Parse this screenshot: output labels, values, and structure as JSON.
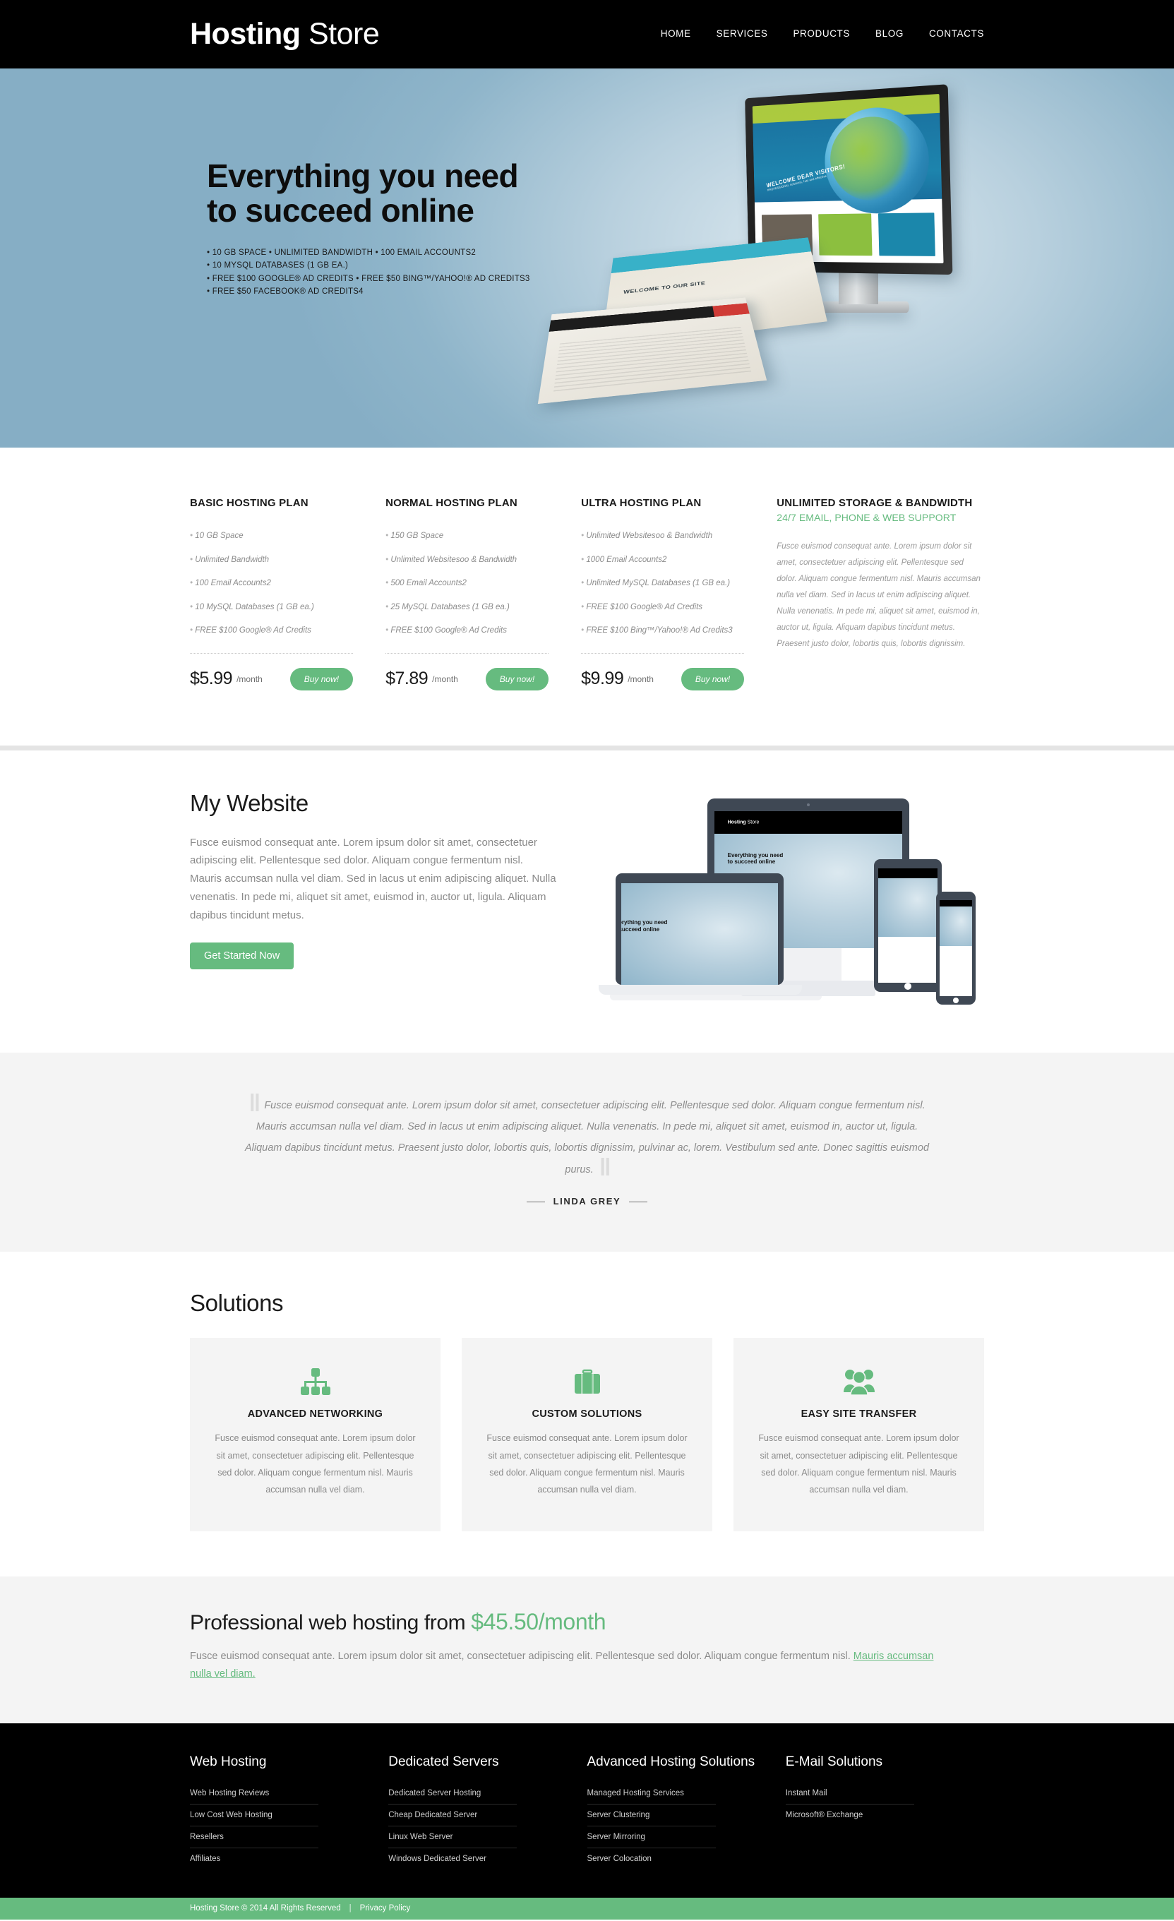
{
  "header": {
    "logo_bold": "Hosting",
    "logo_light": "Store",
    "nav": [
      {
        "label": "HOME"
      },
      {
        "label": "SERVICES"
      },
      {
        "label": "PRODUCTS"
      },
      {
        "label": "BLOG"
      },
      {
        "label": "CONTACTS"
      }
    ]
  },
  "hero": {
    "title_line1": "Everything you need",
    "title_line2": "to succeed online",
    "bullets": [
      "10 GB SPACE • UNLIMITED BANDWIDTH • 100 EMAIL ACCOUNTS2",
      "10 MYSQL DATABASES (1 GB EA.)",
      "FREE $100 GOOGLE® AD CREDITS • FREE $50 BING™/YAHOO!® AD CREDITS3",
      "FREE $50 FACEBOOK® AD CREDITS4"
    ],
    "artwork_screen_heading": "WELCOME DEAR VISITORS!",
    "artwork_screen_sub": "PROFESSIONAL solutions, fast and effective",
    "artwork_flyer_heading": "WELCOME TO OUR SITE"
  },
  "plans": [
    {
      "title": "BASIC HOSTING PLAN",
      "features": [
        "10 GB Space",
        "Unlimited Bandwidth",
        "100 Email Accounts2",
        "10 MySQL Databases (1 GB ea.)",
        "FREE $100 Google® Ad Credits"
      ],
      "price": "$5.99",
      "period": "/month",
      "buy_label": "Buy now!"
    },
    {
      "title": "NORMAL HOSTING PLAN",
      "features": [
        "150 GB Space",
        "Unlimited Websitesoo & Bandwidth",
        "500 Email Accounts2",
        "25 MySQL Databases (1 GB ea.)",
        "FREE $100 Google® Ad Credits"
      ],
      "price": "$7.89",
      "period": "/month",
      "buy_label": "Buy now!"
    },
    {
      "title": "ULTRA HOSTING PLAN",
      "features": [
        "Unlimited Websitesoo & Bandwidth",
        "1000 Email Accounts2",
        "Unlimited MySQL Databases (1 GB ea.)",
        "FREE $100 Google® Ad Credits",
        "FREE $100 Bing™/Yahoo!® Ad Credits3"
      ],
      "price": "$9.99",
      "period": "/month",
      "buy_label": "Buy now!"
    }
  ],
  "promo": {
    "title": "UNLIMITED STORAGE & BANDWIDTH",
    "subtitle": "24/7 EMAIL, PHONE & WEB SUPPORT",
    "body": "Fusce euismod consequat ante. Lorem ipsum dolor sit amet, consectetuer adipiscing elit. Pellentesque sed dolor. Aliquam congue fermentum nisl. Mauris accumsan nulla vel diam. Sed in lacus ut enim adipiscing aliquet. Nulla venenatis. In pede mi, aliquet sit amet, euismod in, auctor ut, ligula. Aliquam dapibus tincidunt metus. Praesent justo dolor, lobortis quis, lobortis dignissim."
  },
  "mywebsite": {
    "title": "My Website",
    "body": "Fusce euismod consequat ante. Lorem ipsum dolor sit amet, consectetuer adipiscing elit. Pellentesque sed dolor. Aliquam congue fermentum nisl. Mauris accumsan nulla vel diam. Sed in lacus ut enim adipiscing aliquet. Nulla venenatis. In pede mi, aliquet sit amet, euismod in, auctor ut, ligula. Aliquam dapibus tincidunt metus.",
    "button": "Get Started Now",
    "mock_logo_bold": "Hosting",
    "mock_logo_light": "Store",
    "mock_headline_line1": "Everything you need",
    "mock_headline_line2": "to succeed online"
  },
  "quote": {
    "open_mark": "██",
    "close_mark": "██",
    "text": "Fusce euismod consequat ante. Lorem ipsum dolor sit amet, consectetuer adipiscing elit. Pellentesque sed dolor. Aliquam congue fermentum nisl. Mauris accumsan nulla vel diam. Sed in lacus ut enim adipiscing aliquet. Nulla venenatis. In pede mi, aliquet sit amet, euismod in, auctor ut, ligula. Aliquam dapibus tincidunt metus. Praesent justo dolor, lobortis quis, lobortis dignissim, pulvinar ac, lorem. Vestibulum sed ante. Donec sagittis euismod purus.",
    "author": "LINDA GREY"
  },
  "solutions": {
    "title": "Solutions",
    "cards": [
      {
        "icon": "network-icon",
        "title": "ADVANCED NETWORKING",
        "body": "Fusce euismod consequat ante. Lorem ipsum dolor sit amet, consectetuer adipiscing elit. Pellentesque sed dolor. Aliquam congue fermentum nisl. Mauris accumsan nulla vel diam."
      },
      {
        "icon": "briefcase-icon",
        "title": "CUSTOM SOLUTIONS",
        "body": "Fusce euismod consequat ante. Lorem ipsum dolor sit amet, consectetuer adipiscing elit. Pellentesque sed dolor. Aliquam congue fermentum nisl. Mauris accumsan nulla vel diam."
      },
      {
        "icon": "users-group-icon",
        "title": "EASY SITE TRANSFER",
        "body": "Fusce euismod consequat ante. Lorem ipsum dolor sit amet, consectetuer adipiscing elit. Pellentesque sed dolor. Aliquam congue fermentum nisl. Mauris accumsan nulla vel diam."
      }
    ]
  },
  "cta": {
    "lead": "Professional web hosting from ",
    "price": "$45.50/month",
    "body_before": "Fusce euismod consequat ante. Lorem ipsum dolor sit amet, consectetuer adipiscing elit. Pellentesque sed dolor. Aliquam congue fermentum nisl. ",
    "link": "Mauris accumsan nulla vel diam."
  },
  "footer": {
    "columns": [
      {
        "title": "Web Hosting",
        "links": [
          "Web Hosting Reviews",
          "Low Cost Web Hosting",
          "Resellers",
          "Affiliates"
        ]
      },
      {
        "title": "Dedicated Servers",
        "links": [
          "Dedicated Server Hosting",
          "Cheap Dedicated Server",
          "Linux Web Server",
          "Windows Dedicated Server"
        ]
      },
      {
        "title": "Advanced Hosting Solutions",
        "links": [
          "Managed Hosting Services",
          "Server Clustering",
          "Server Mirroring",
          "Server Colocation"
        ]
      },
      {
        "title": "E-Mail Solutions",
        "links": [
          "Instant Mail",
          "Microsoft® Exchange"
        ]
      }
    ],
    "copyright": "Hosting Store © 2014 All Rights Reserved",
    "separator": "|",
    "privacy": "Privacy Policy"
  },
  "colors": {
    "accent_green": "#66bb7f",
    "header_black": "#000000",
    "section_gray": "#f4f4f4",
    "divider_gray": "#e4e4e4",
    "hero_blue": "#8fb5ca"
  }
}
